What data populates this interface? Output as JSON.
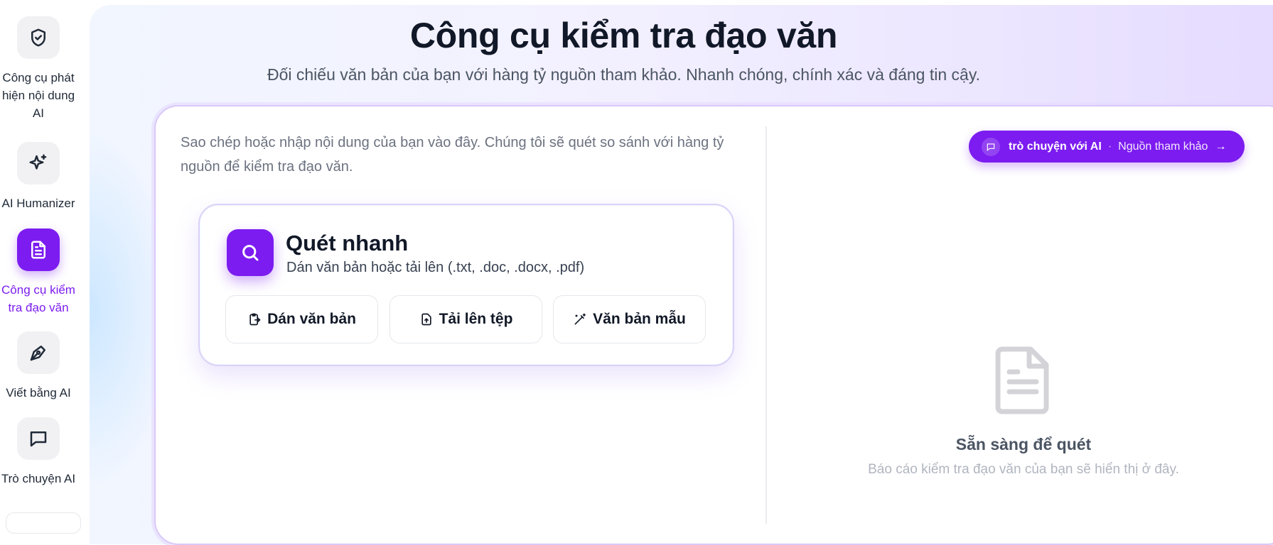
{
  "sidebar": {
    "items": [
      {
        "label": "Công cụ phát hiện nội dung AI",
        "icon": "shield-check-icon"
      },
      {
        "label": "AI Humanizer",
        "icon": "sparkle-icon"
      },
      {
        "label": "Công cụ kiểm tra đạo văn",
        "icon": "document-icon",
        "active": true
      },
      {
        "label": "Viết bằng AI",
        "icon": "pen-nib-icon"
      },
      {
        "label": "Trò chuyện AI",
        "icon": "chat-bubble-icon"
      }
    ]
  },
  "header": {
    "title": "Công cụ kiểm tra đạo văn",
    "subtitle": "Đối chiếu văn bản của bạn với hàng tỷ nguồn tham khảo. Nhanh chóng, chính xác và đáng tin cậy."
  },
  "editor": {
    "placeholder": "Sao chép hoặc nhập nội dung của bạn vào đây. Chúng tôi sẽ quét so sánh với hàng tỷ nguồn để kiểm tra đạo văn."
  },
  "quick_scan": {
    "title": "Quét nhanh",
    "subtitle": "Dán văn bản hoặc tải lên (.txt, .doc, .docx, .pdf)",
    "buttons": [
      {
        "label": "Dán văn bản",
        "icon": "clipboard-paste-icon"
      },
      {
        "label": "Tải lên tệp",
        "icon": "file-upload-icon"
      },
      {
        "label": "Văn bản mẫu",
        "icon": "magic-wand-icon"
      }
    ]
  },
  "chat_pill": {
    "strong": "trò chuyện với AI",
    "separator": "·",
    "light": "Nguồn tham khảo",
    "arrow": "→"
  },
  "results": {
    "title": "Sẵn sàng để quét",
    "subtitle": "Báo cáo kiểm tra đạo văn của bạn sẽ hiển thị ở đây."
  },
  "colors": {
    "accent": "#7c1cf0",
    "text": "#111827",
    "muted": "#6b7280"
  }
}
